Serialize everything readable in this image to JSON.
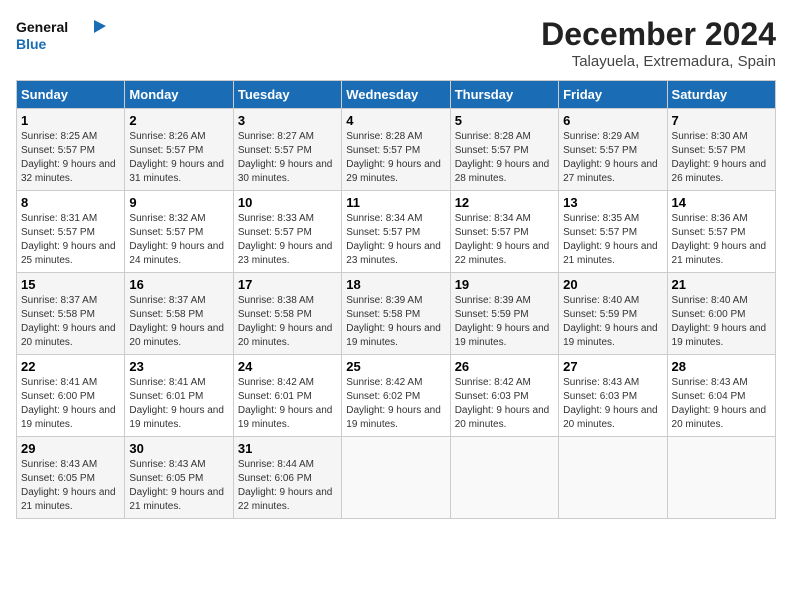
{
  "logo": {
    "line1": "General",
    "line2": "Blue"
  },
  "title": "December 2024",
  "subtitle": "Talayuela, Extremadura, Spain",
  "days_of_week": [
    "Sunday",
    "Monday",
    "Tuesday",
    "Wednesday",
    "Thursday",
    "Friday",
    "Saturday"
  ],
  "weeks": [
    [
      {
        "day": "1",
        "sunrise": "8:25 AM",
        "sunset": "5:57 PM",
        "daylight": "9 hours and 32 minutes."
      },
      {
        "day": "2",
        "sunrise": "8:26 AM",
        "sunset": "5:57 PM",
        "daylight": "9 hours and 31 minutes."
      },
      {
        "day": "3",
        "sunrise": "8:27 AM",
        "sunset": "5:57 PM",
        "daylight": "9 hours and 30 minutes."
      },
      {
        "day": "4",
        "sunrise": "8:28 AM",
        "sunset": "5:57 PM",
        "daylight": "9 hours and 29 minutes."
      },
      {
        "day": "5",
        "sunrise": "8:28 AM",
        "sunset": "5:57 PM",
        "daylight": "9 hours and 28 minutes."
      },
      {
        "day": "6",
        "sunrise": "8:29 AM",
        "sunset": "5:57 PM",
        "daylight": "9 hours and 27 minutes."
      },
      {
        "day": "7",
        "sunrise": "8:30 AM",
        "sunset": "5:57 PM",
        "daylight": "9 hours and 26 minutes."
      }
    ],
    [
      {
        "day": "8",
        "sunrise": "8:31 AM",
        "sunset": "5:57 PM",
        "daylight": "9 hours and 25 minutes."
      },
      {
        "day": "9",
        "sunrise": "8:32 AM",
        "sunset": "5:57 PM",
        "daylight": "9 hours and 24 minutes."
      },
      {
        "day": "10",
        "sunrise": "8:33 AM",
        "sunset": "5:57 PM",
        "daylight": "9 hours and 23 minutes."
      },
      {
        "day": "11",
        "sunrise": "8:34 AM",
        "sunset": "5:57 PM",
        "daylight": "9 hours and 23 minutes."
      },
      {
        "day": "12",
        "sunrise": "8:34 AM",
        "sunset": "5:57 PM",
        "daylight": "9 hours and 22 minutes."
      },
      {
        "day": "13",
        "sunrise": "8:35 AM",
        "sunset": "5:57 PM",
        "daylight": "9 hours and 21 minutes."
      },
      {
        "day": "14",
        "sunrise": "8:36 AM",
        "sunset": "5:57 PM",
        "daylight": "9 hours and 21 minutes."
      }
    ],
    [
      {
        "day": "15",
        "sunrise": "8:37 AM",
        "sunset": "5:58 PM",
        "daylight": "9 hours and 20 minutes."
      },
      {
        "day": "16",
        "sunrise": "8:37 AM",
        "sunset": "5:58 PM",
        "daylight": "9 hours and 20 minutes."
      },
      {
        "day": "17",
        "sunrise": "8:38 AM",
        "sunset": "5:58 PM",
        "daylight": "9 hours and 20 minutes."
      },
      {
        "day": "18",
        "sunrise": "8:39 AM",
        "sunset": "5:58 PM",
        "daylight": "9 hours and 19 minutes."
      },
      {
        "day": "19",
        "sunrise": "8:39 AM",
        "sunset": "5:59 PM",
        "daylight": "9 hours and 19 minutes."
      },
      {
        "day": "20",
        "sunrise": "8:40 AM",
        "sunset": "5:59 PM",
        "daylight": "9 hours and 19 minutes."
      },
      {
        "day": "21",
        "sunrise": "8:40 AM",
        "sunset": "6:00 PM",
        "daylight": "9 hours and 19 minutes."
      }
    ],
    [
      {
        "day": "22",
        "sunrise": "8:41 AM",
        "sunset": "6:00 PM",
        "daylight": "9 hours and 19 minutes."
      },
      {
        "day": "23",
        "sunrise": "8:41 AM",
        "sunset": "6:01 PM",
        "daylight": "9 hours and 19 minutes."
      },
      {
        "day": "24",
        "sunrise": "8:42 AM",
        "sunset": "6:01 PM",
        "daylight": "9 hours and 19 minutes."
      },
      {
        "day": "25",
        "sunrise": "8:42 AM",
        "sunset": "6:02 PM",
        "daylight": "9 hours and 19 minutes."
      },
      {
        "day": "26",
        "sunrise": "8:42 AM",
        "sunset": "6:03 PM",
        "daylight": "9 hours and 20 minutes."
      },
      {
        "day": "27",
        "sunrise": "8:43 AM",
        "sunset": "6:03 PM",
        "daylight": "9 hours and 20 minutes."
      },
      {
        "day": "28",
        "sunrise": "8:43 AM",
        "sunset": "6:04 PM",
        "daylight": "9 hours and 20 minutes."
      }
    ],
    [
      {
        "day": "29",
        "sunrise": "8:43 AM",
        "sunset": "6:05 PM",
        "daylight": "9 hours and 21 minutes."
      },
      {
        "day": "30",
        "sunrise": "8:43 AM",
        "sunset": "6:05 PM",
        "daylight": "9 hours and 21 minutes."
      },
      {
        "day": "31",
        "sunrise": "8:44 AM",
        "sunset": "6:06 PM",
        "daylight": "9 hours and 22 minutes."
      },
      null,
      null,
      null,
      null
    ]
  ],
  "labels": {
    "sunrise": "Sunrise:",
    "sunset": "Sunset:",
    "daylight": "Daylight:"
  }
}
